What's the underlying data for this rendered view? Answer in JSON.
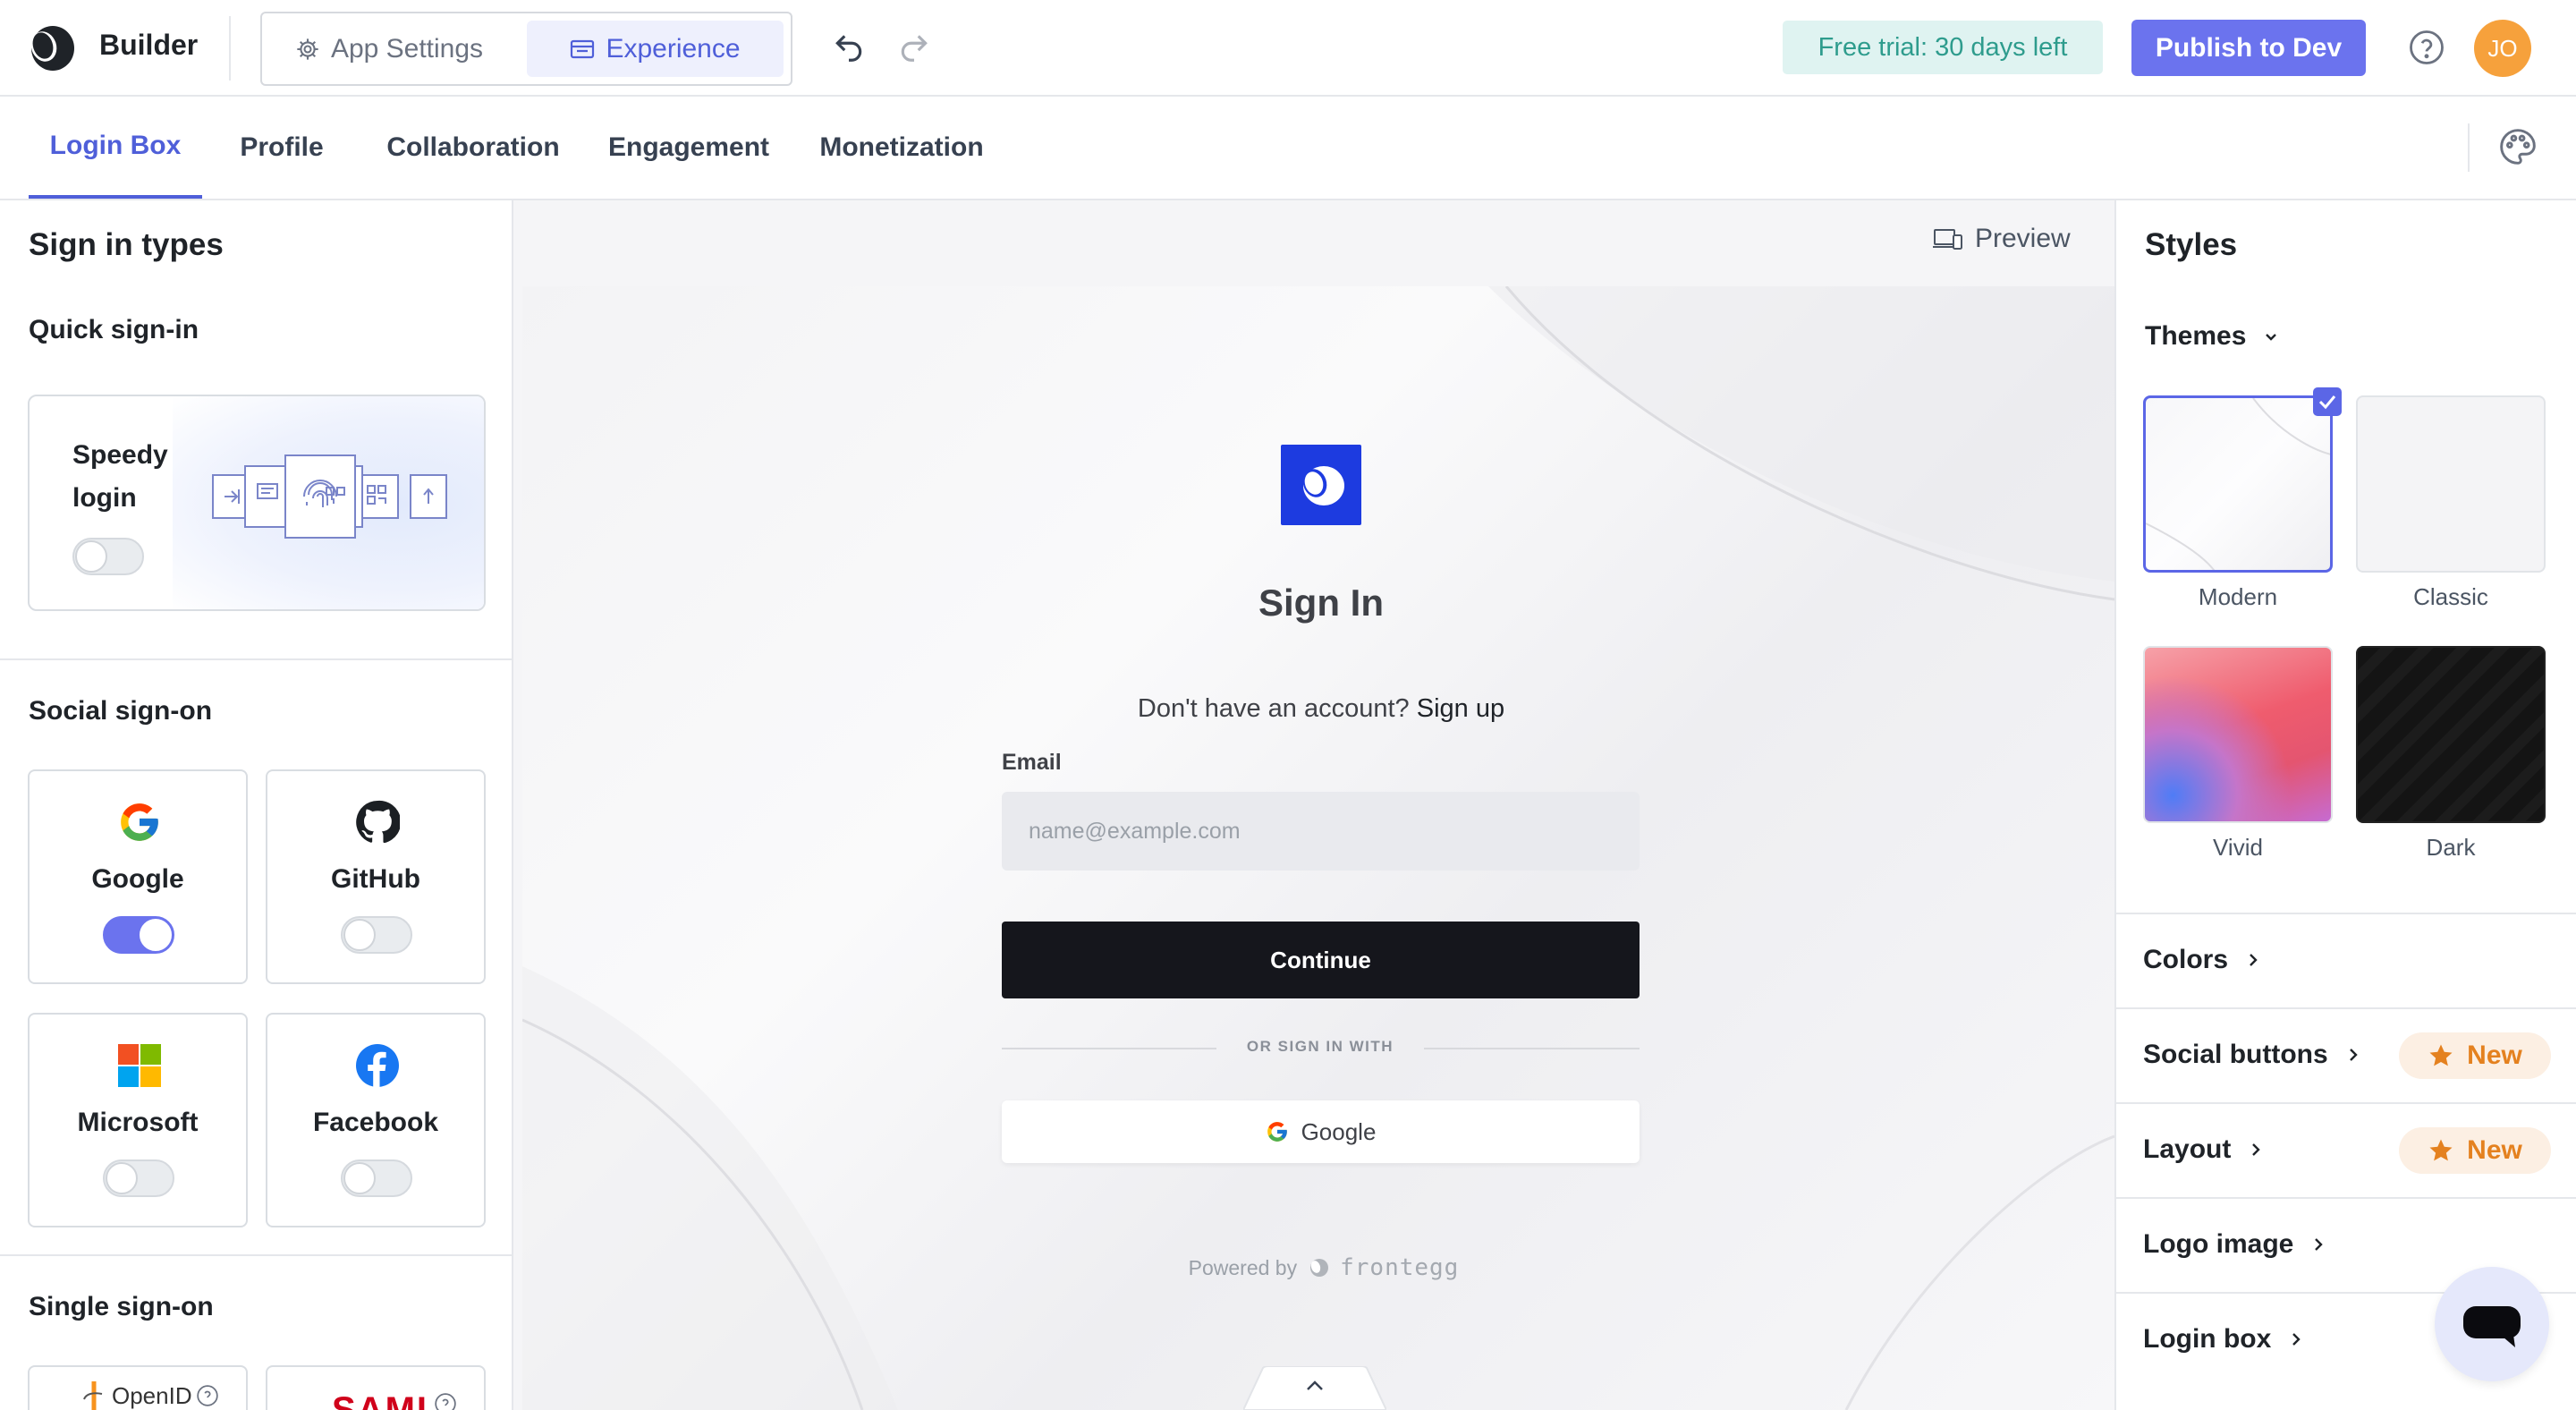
{
  "header": {
    "brand": "Builder",
    "tabs": {
      "app_settings": "App Settings",
      "experience": "Experience"
    },
    "trial": "Free trial: 30 days left",
    "publish": "Publish to Dev",
    "avatar_initials": "JO"
  },
  "nav": {
    "tabs": [
      "Login Box",
      "Profile",
      "Collaboration",
      "Engagement",
      "Monetization"
    ],
    "active": "Login Box"
  },
  "left": {
    "title": "Sign in types",
    "quick": {
      "heading": "Quick sign-in",
      "speedy_label": "Speedy login",
      "speedy_enabled": false
    },
    "social": {
      "heading": "Social sign-on",
      "providers": [
        {
          "label": "Google",
          "enabled": true,
          "icon": "google-icon"
        },
        {
          "label": "GitHub",
          "enabled": false,
          "icon": "github-icon"
        },
        {
          "label": "Microsoft",
          "enabled": false,
          "icon": "microsoft-icon"
        },
        {
          "label": "Facebook",
          "enabled": false,
          "icon": "facebook-icon"
        }
      ]
    },
    "sso": {
      "heading": "Single sign-on",
      "providers": [
        "OpenID",
        "SAML"
      ]
    }
  },
  "preview": {
    "button": "Preview",
    "title": "Sign In",
    "signup_prompt": "Don't have an account?",
    "signup_link": "Sign up",
    "email_label": "Email",
    "email_placeholder": "name@example.com",
    "continue": "Continue",
    "divider": "OR SIGN IN WITH",
    "google": "Google",
    "powered_by": "Powered by",
    "powered_brand": "frontegg"
  },
  "styles": {
    "title": "Styles",
    "themes_label": "Themes",
    "themes": [
      {
        "name": "Modern",
        "selected": true
      },
      {
        "name": "Classic",
        "selected": false
      },
      {
        "name": "Vivid",
        "selected": false
      },
      {
        "name": "Dark",
        "selected": false
      }
    ],
    "rows": [
      {
        "label": "Colors",
        "badge": ""
      },
      {
        "label": "Social buttons",
        "badge": "New"
      },
      {
        "label": "Layout",
        "badge": "New"
      },
      {
        "label": "Logo image",
        "badge": ""
      },
      {
        "label": "Login box",
        "badge": ""
      }
    ]
  },
  "colors": {
    "accent": "#6b73ee",
    "brand_logo": "#1d3be0",
    "trial_bg": "#dff3f1",
    "new_badge": "#e4811f"
  }
}
